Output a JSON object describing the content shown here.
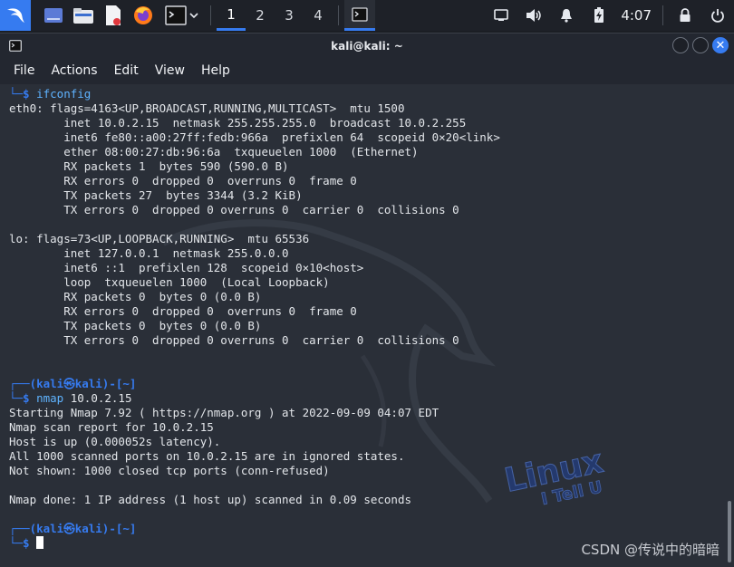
{
  "panel": {
    "workspaces": [
      "1",
      "2",
      "3",
      "4"
    ],
    "clock": "4:07"
  },
  "window": {
    "title": "kali@kali: ~",
    "menu": [
      "File",
      "Actions",
      "Edit",
      "View",
      "Help"
    ]
  },
  "terminal": {
    "lines": [
      {
        "type": "cmd",
        "prompt": "└─$ ",
        "command": "ifconfig",
        "args": ""
      },
      {
        "type": "text",
        "text": "eth0: flags=4163<UP,BROADCAST,RUNNING,MULTICAST>  mtu 1500"
      },
      {
        "type": "text",
        "text": "        inet 10.0.2.15  netmask 255.255.255.0  broadcast 10.0.2.255"
      },
      {
        "type": "text",
        "text": "        inet6 fe80::a00:27ff:fedb:966a  prefixlen 64  scopeid 0×20<link>"
      },
      {
        "type": "text",
        "text": "        ether 08:00:27:db:96:6a  txqueuelen 1000  (Ethernet)"
      },
      {
        "type": "text",
        "text": "        RX packets 1  bytes 590 (590.0 B)"
      },
      {
        "type": "text",
        "text": "        RX errors 0  dropped 0  overruns 0  frame 0"
      },
      {
        "type": "text",
        "text": "        TX packets 27  bytes 3344 (3.2 KiB)"
      },
      {
        "type": "text",
        "text": "        TX errors 0  dropped 0 overruns 0  carrier 0  collisions 0"
      },
      {
        "type": "text",
        "text": ""
      },
      {
        "type": "text",
        "text": "lo: flags=73<UP,LOOPBACK,RUNNING>  mtu 65536"
      },
      {
        "type": "text",
        "text": "        inet 127.0.0.1  netmask 255.0.0.0"
      },
      {
        "type": "text",
        "text": "        inet6 ::1  prefixlen 128  scopeid 0×10<host>"
      },
      {
        "type": "text",
        "text": "        loop  txqueuelen 1000  (Local Loopback)"
      },
      {
        "type": "text",
        "text": "        RX packets 0  bytes 0 (0.0 B)"
      },
      {
        "type": "text",
        "text": "        RX errors 0  dropped 0  overruns 0  frame 0"
      },
      {
        "type": "text",
        "text": "        TX packets 0  bytes 0 (0.0 B)"
      },
      {
        "type": "text",
        "text": "        TX errors 0  dropped 0 overruns 0  carrier 0  collisions 0"
      },
      {
        "type": "text",
        "text": ""
      },
      {
        "type": "text",
        "text": ""
      },
      {
        "type": "header",
        "text": "┌──(kali㉿kali)-[~]"
      },
      {
        "type": "cmd",
        "prompt": "└─$ ",
        "command": "nmap",
        "args": " 10.0.2.15"
      },
      {
        "type": "text",
        "text": "Starting Nmap 7.92 ( https://nmap.org ) at 2022-09-09 04:07 EDT"
      },
      {
        "type": "text",
        "text": "Nmap scan report for 10.0.2.15"
      },
      {
        "type": "text",
        "text": "Host is up (0.000052s latency)."
      },
      {
        "type": "text",
        "text": "All 1000 scanned ports on 10.0.2.15 are in ignored states."
      },
      {
        "type": "text",
        "text": "Not shown: 1000 closed tcp ports (conn-refused)"
      },
      {
        "type": "text",
        "text": ""
      },
      {
        "type": "text",
        "text": "Nmap done: 1 IP address (1 host up) scanned in 0.09 seconds"
      },
      {
        "type": "text",
        "text": ""
      },
      {
        "type": "header",
        "text": "┌──(kali㉿kali)-[~]"
      },
      {
        "type": "prompt",
        "prompt": "└─$ "
      }
    ]
  },
  "watermark": "CSDN @传说中的暗暗",
  "colors": {
    "accent": "#367bf0",
    "command": "#5fb3ff",
    "terminal_bg": "#2a2f38",
    "panel_bg": "#1e2128"
  }
}
